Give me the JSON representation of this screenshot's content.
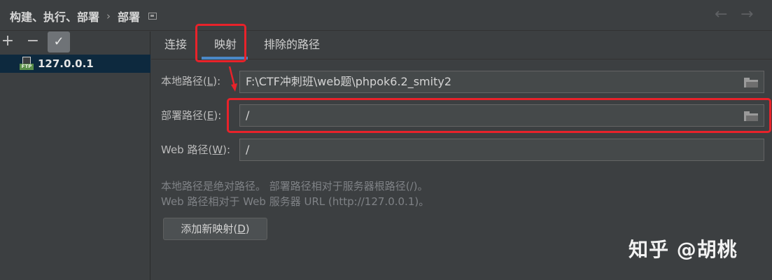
{
  "breadcrumb": {
    "parent": "构建、执行、部署",
    "separator": "›",
    "current": "部署"
  },
  "nav": {
    "back_glyph": "←",
    "forward_glyph": "→"
  },
  "sidebar": {
    "add_glyph": "+",
    "remove_glyph": "−",
    "check_glyph": "✓",
    "server": {
      "icon_tag": "FTP",
      "label": "127.0.0.1"
    }
  },
  "tabs": [
    {
      "label": "连接"
    },
    {
      "label": "映射",
      "selected": true
    },
    {
      "label": "排除的路径"
    }
  ],
  "mapping": {
    "local_path": {
      "label_prefix": "本地路径(",
      "mnemonic": "L",
      "label_suffix": "):",
      "value": "F:\\CTF冲刺班\\web题\\phpok6.2_smity2"
    },
    "deploy_path": {
      "label_prefix": "部署路径(",
      "mnemonic": "E",
      "label_suffix": "):",
      "value": "/"
    },
    "web_path": {
      "label_prefix": "Web 路径(",
      "mnemonic": "W",
      "label_suffix": "):",
      "value": "/"
    },
    "hint_line1": "本地路径是绝对路径。 部署路径相对于服务器根路径(/)。",
    "hint_line2": "Web 路径相对于 Web 服务器 URL (http://127.0.0.1)。",
    "add_button": {
      "label_prefix": "添加新映射(",
      "mnemonic": "D",
      "label_suffix": ")"
    }
  },
  "watermark": "知乎 @胡桃",
  "colors": {
    "background": "#3c3f41",
    "selection": "#0d293e",
    "tab_underline": "#4a88c7",
    "annotation_red": "#e8222a",
    "ftp_green": "#5a8f4a"
  }
}
